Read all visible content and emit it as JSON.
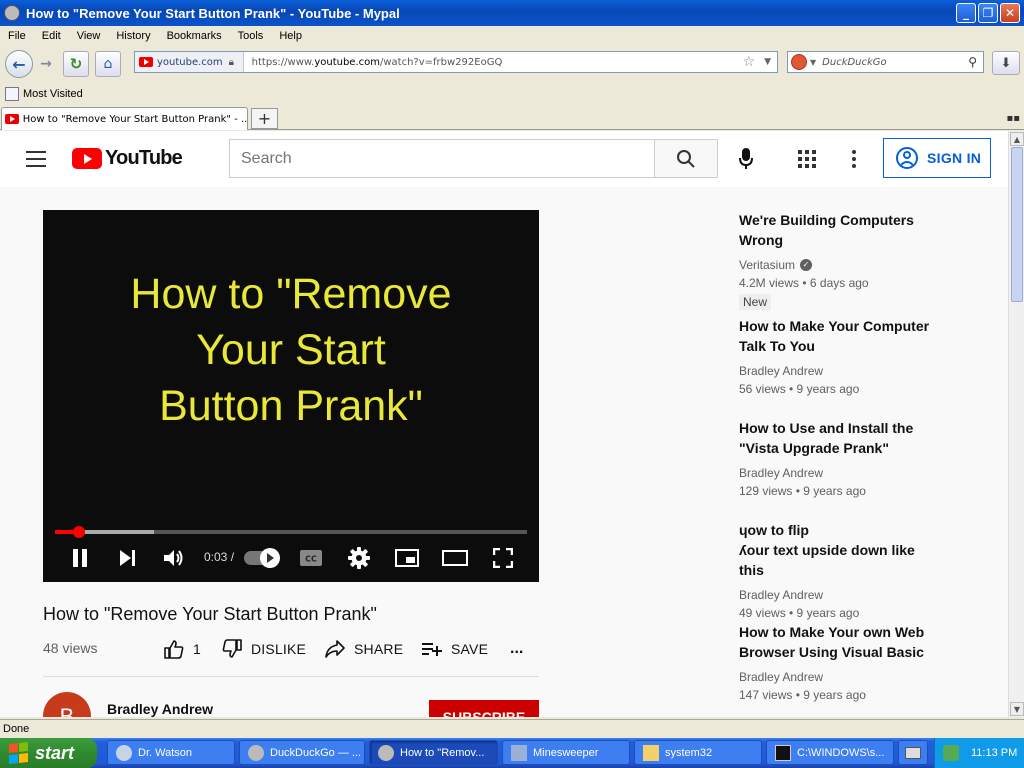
{
  "window": {
    "title": "How to \"Remove Your Start Button Prank\" - YouTube - Mypal",
    "minimize": "_",
    "maximize": "❐",
    "close": "✕"
  },
  "menu": [
    "File",
    "Edit",
    "View",
    "History",
    "Bookmarks",
    "Tools",
    "Help"
  ],
  "nav": {
    "site_identity": "youtube.com",
    "url_prefix": "https://www.",
    "url_domain": "youtube.com",
    "url_path": "/watch?v=frbw292EoGQ",
    "search_placeholder": "DuckDuckGo"
  },
  "bookmarks": {
    "most_visited": "Most Visited"
  },
  "tab": {
    "label": "How to \"Remove Your Start Button Prank\" - ...",
    "new_tab": "+"
  },
  "youtube": {
    "logo_text": "YouTube",
    "search_placeholder": "Search",
    "sign_in": "SIGN IN"
  },
  "player": {
    "title_card": "How to \"Remove\nYour Start\nButton Prank\"",
    "time": "0:03 /",
    "progress_fraction": 0.05,
    "buffered_fraction": 0.21
  },
  "video": {
    "title": "How to \"Remove Your Start Button Prank\"",
    "views": "48 views",
    "likes": "1",
    "dislike": "DISLIKE",
    "share": "SHARE",
    "save": "SAVE",
    "more": "..."
  },
  "channel": {
    "avatar_letter": "B",
    "name": "Bradley Andrew",
    "subscribe": "SUBSCRIBE"
  },
  "related": [
    {
      "title": "We're Building Computers\nWrong",
      "channel": "Veritasium",
      "verified": true,
      "meta": "4.2M views • 6 days ago",
      "badge": "New"
    },
    {
      "title": "How to Make Your Computer\nTalk To You",
      "channel": "Bradley Andrew",
      "meta": "56 views • 9 years ago"
    },
    {
      "title": "How to Use and Install the\n\"Vista Upgrade Prank\"",
      "channel": "Bradley Andrew",
      "meta": "129 views • 9 years ago"
    },
    {
      "title": "ɥow to flip\nʎour text upside down like this",
      "channel": "Bradley Andrew",
      "meta": "49 views • 9 years ago"
    },
    {
      "title": "How to Make Your own Web\nBrowser Using Visual Basic",
      "channel": "Bradley Andrew",
      "meta": "147 views • 9 years ago"
    }
  ],
  "status": {
    "text": "Done"
  },
  "taskbar": {
    "start": "start",
    "buttons": [
      {
        "label": "Dr. Watson",
        "active": false
      },
      {
        "label": "DuckDuckGo — ...",
        "active": false
      },
      {
        "label": "How to \"Remov...",
        "active": true
      },
      {
        "label": "Minesweeper",
        "active": false
      },
      {
        "label": "system32",
        "active": false
      },
      {
        "label": "C:\\WINDOWS\\s...",
        "active": false
      }
    ],
    "clock": "11:13 PM"
  },
  "colors": {
    "youtube_red": "#ff0000",
    "link_blue": "#065fd4",
    "title_card_yellow": "#e8e838",
    "xp_blue": "#245edb",
    "xp_green": "#2f8a2f"
  }
}
